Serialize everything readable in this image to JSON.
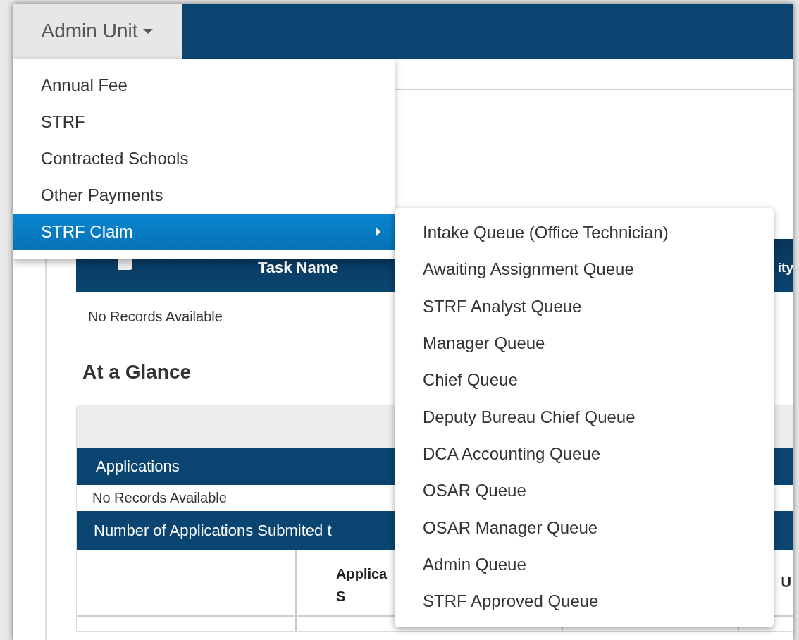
{
  "nav_tab": {
    "label": "Admin Unit",
    "open": true
  },
  "menu": {
    "items": [
      {
        "label": "Annual Fee",
        "selected": false,
        "has_submenu": false
      },
      {
        "label": "STRF",
        "selected": false,
        "has_submenu": false
      },
      {
        "label": "Contracted Schools",
        "selected": false,
        "has_submenu": false
      },
      {
        "label": "Other Payments",
        "selected": false,
        "has_submenu": false
      },
      {
        "label": "STRF Claim",
        "selected": true,
        "has_submenu": true
      }
    ]
  },
  "submenu": {
    "items": [
      {
        "label": "Intake Queue (Office Technician)",
        "selected": false
      },
      {
        "label": "Awaiting Assignment Queue",
        "selected": false
      },
      {
        "label": "STRF Analyst Queue",
        "selected": false
      },
      {
        "label": "Manager Queue",
        "selected": false
      },
      {
        "label": "Chief Queue",
        "selected": false
      },
      {
        "label": "Deputy Bureau Chief Queue",
        "selected": false
      },
      {
        "label": "DCA Accounting Queue",
        "selected": false
      },
      {
        "label": "OSAR Queue",
        "selected": false
      },
      {
        "label": "OSAR Manager Queue",
        "selected": false
      },
      {
        "label": "Admin Queue",
        "selected": false
      },
      {
        "label": "STRF Approved Queue",
        "selected": false
      }
    ]
  },
  "tasks_table": {
    "select_all_checked": false,
    "columns": [
      "Task Name",
      "ity"
    ],
    "empty_message": "No Records Available"
  },
  "glance": {
    "title": "At a Glance",
    "applications": {
      "title": "Applications",
      "empty_message": "No Records Available"
    },
    "submitted": {
      "title": "Number of Applications Submited t",
      "columns": [
        "",
        "Applica\nS",
        "",
        "U"
      ]
    }
  }
}
